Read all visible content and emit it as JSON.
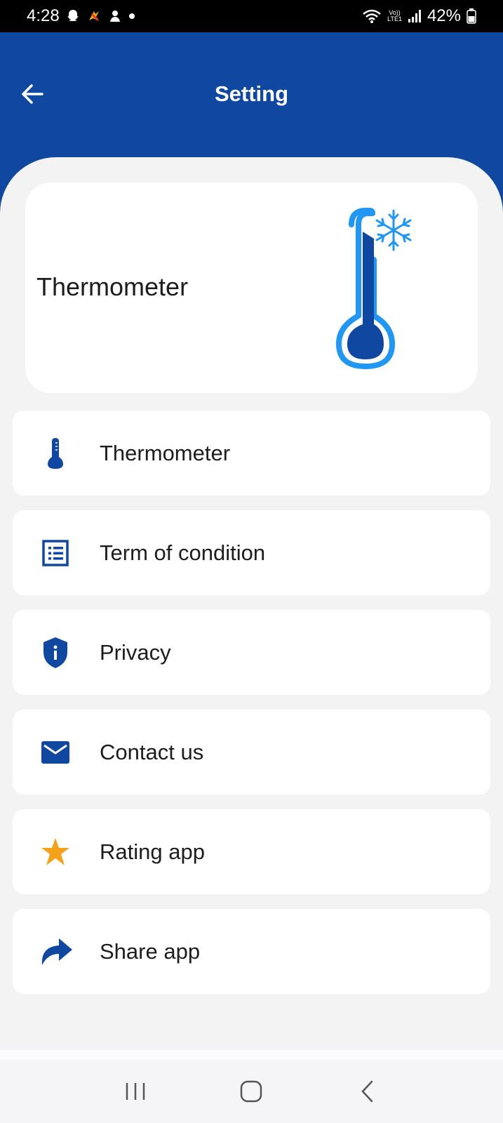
{
  "status_bar": {
    "time": "4:28",
    "battery": "42%",
    "network_top": "Vo))",
    "network_bottom": "LTE1"
  },
  "header": {
    "title": "Setting"
  },
  "hero": {
    "title": "Thermometer"
  },
  "menu": {
    "items": [
      {
        "label": "Thermometer",
        "icon": "thermometer-icon"
      },
      {
        "label": "Term of condition",
        "icon": "list-icon"
      },
      {
        "label": "Privacy",
        "icon": "privacy-shield-icon"
      },
      {
        "label": "Contact us",
        "icon": "mail-icon"
      },
      {
        "label": "Rating app",
        "icon": "star-icon"
      },
      {
        "label": "Share app",
        "icon": "share-icon"
      }
    ]
  },
  "colors": {
    "primary": "#0f47a1",
    "accent_light": "#2196f3",
    "star": "#f5a21b",
    "background": "#f3f3f3"
  }
}
